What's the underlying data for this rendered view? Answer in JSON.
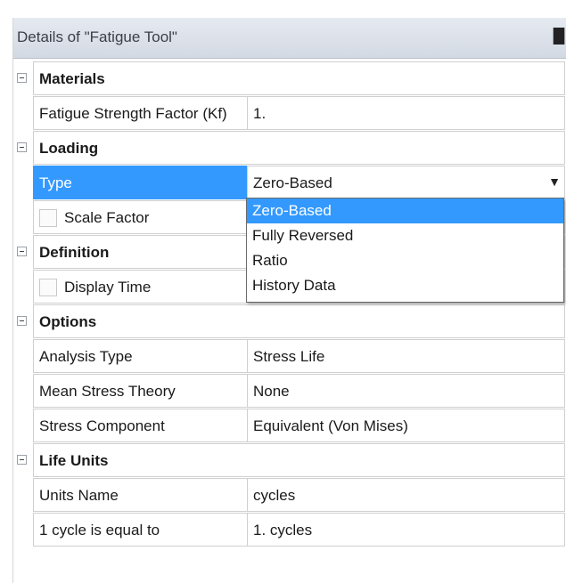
{
  "window": {
    "title": "Details of \"Fatigue Tool\"",
    "pin_glyph": "█"
  },
  "groups": [
    {
      "name": "Materials",
      "rows": [
        {
          "label": "Fatigue Strength Factor (Kf)",
          "value": "1."
        }
      ]
    },
    {
      "name": "Loading",
      "rows": [
        {
          "label": "Type",
          "value": "Zero-Based"
        },
        {
          "label": "Scale Factor",
          "value": ""
        }
      ]
    },
    {
      "name": "Definition",
      "rows": [
        {
          "label": "Display Time",
          "value": ""
        }
      ]
    },
    {
      "name": "Options",
      "rows": [
        {
          "label": "Analysis Type",
          "value": "Stress Life"
        },
        {
          "label": "Mean Stress Theory",
          "value": "None"
        },
        {
          "label": "Stress Component",
          "value": "Equivalent (Von Mises)"
        }
      ]
    },
    {
      "name": "Life Units",
      "rows": [
        {
          "label": "Units Name",
          "value": "cycles"
        },
        {
          "label": "1 cycle is equal to",
          "value": "1. cycles"
        }
      ]
    }
  ],
  "dropdown": {
    "arrow": "▼",
    "options": [
      "Zero-Based",
      "Fully Reversed",
      "Ratio",
      "History Data"
    ],
    "selected": "Zero-Based"
  },
  "colors": {
    "selection": "#3399ff",
    "title_bar": "#dde2ea",
    "grid_line": "#cfcfcf"
  },
  "icons": {
    "expander": "collapse-minus-icon",
    "pin": "pin-icon",
    "checkbox": "checkbox-unchecked-icon",
    "arrow": "dropdown-arrow-icon"
  }
}
